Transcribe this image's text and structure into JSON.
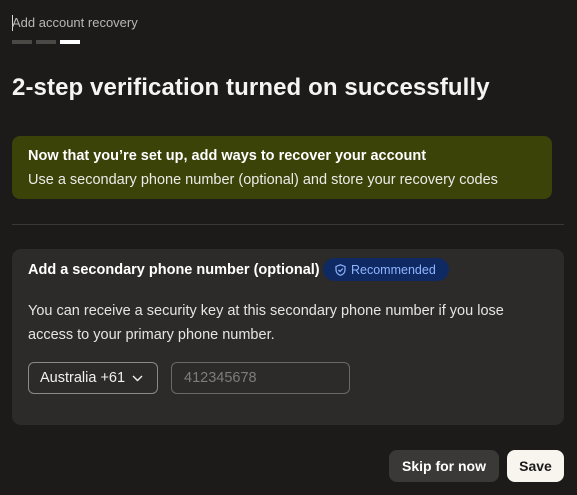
{
  "header": {
    "step_label": "Add account recovery",
    "progress": {
      "total_steps": 3,
      "current_step": 3
    }
  },
  "page_title": "2-step verification turned on successfully",
  "banner": {
    "title": "Now that you’re set up, add ways to recover your account",
    "body": "Use a secondary phone number (optional) and store your recovery codes",
    "color": "#3b4309"
  },
  "secondary_phone_card": {
    "title": "Add a secondary phone number (optional)",
    "badge": {
      "label": "Recommended",
      "icon": "shield-check-icon",
      "color": "#0f2a63"
    },
    "description": "You can receive a security key at this secondary phone number if you lose access to your primary phone number.",
    "country_select": {
      "value": "Australia +61",
      "icon": "chevron-down-icon"
    },
    "phone_input": {
      "value": "",
      "placeholder": "412345678"
    }
  },
  "actions": {
    "skip_label": "Skip for now",
    "save_label": "Save"
  }
}
